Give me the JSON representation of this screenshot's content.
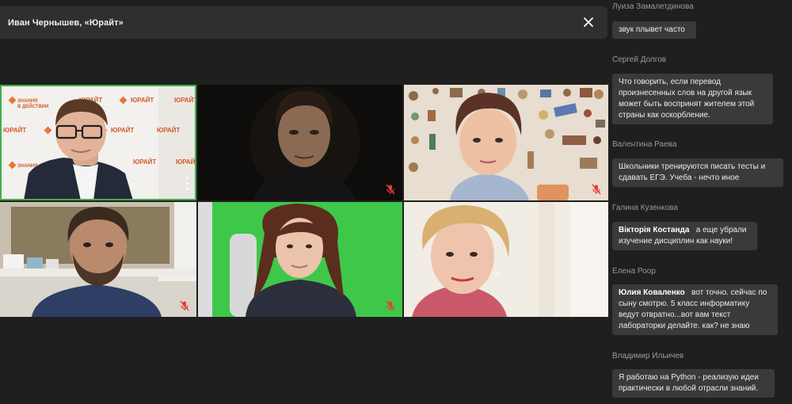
{
  "header": {
    "title": "Иван Чернышев, «Юрайт»"
  },
  "logo": {
    "brand": "ЮРАЙТ",
    "sub": "образовательная платформа",
    "tagline_1": "ЗНАНИЯ",
    "tagline_2": "В ДЕЙСТВИИ"
  },
  "chat": {
    "messages": [
      {
        "sender": "Луиза Замалетдинова",
        "text": "звук плывет часто"
      },
      {
        "sender": "Сергей Долгов",
        "text": "Что говорить, если перевод произнесенных слов на другой язык может быть воспринят жителем этой страны как оскорбление."
      },
      {
        "sender": "Валентина Раева",
        "text": "Школьники тренируются писать тесты и сдавать ЕГЭ. Учеба - нечто иное"
      },
      {
        "sender": "Галина Кузенкова",
        "mention": "Вікторія Костанда",
        "text": "а еще убрали изучение дисциплин как науки!"
      },
      {
        "sender": "Елена Роор",
        "mention": "Юлия Коваленко",
        "text": "вот точно. сейчас по сыну смотрю. 5 класс информатику ведут отвратно...вот вам текст лабораторки делайте. как? не знаю"
      },
      {
        "sender": "Владимир Ильичев",
        "text": "Я работаю на Python - реализую идеи практически в любой отрасли знаний."
      }
    ]
  }
}
